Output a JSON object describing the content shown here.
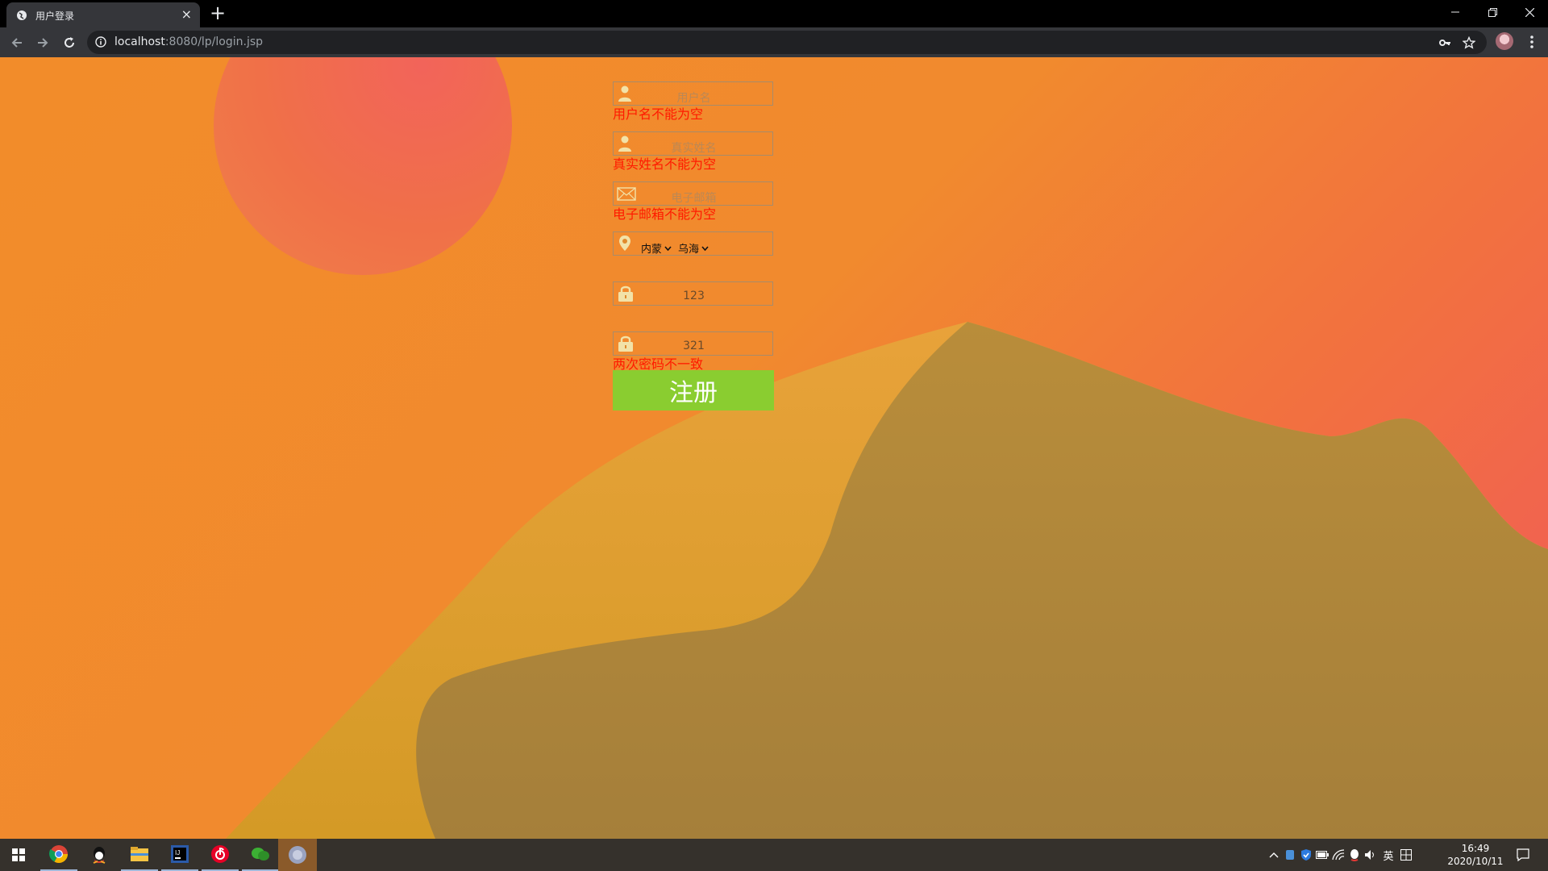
{
  "browser": {
    "tab_title": "用户登录",
    "tab_close": "×",
    "new_tab": "+",
    "url_host": "localhost",
    "url_path": ":8080/lp/login.jsp"
  },
  "form": {
    "username": {
      "placeholder": "用户名",
      "icon": "user-icon",
      "error": "用户名不能为空"
    },
    "realname": {
      "placeholder": "真实姓名",
      "icon": "user-icon",
      "error": "真实姓名不能为空"
    },
    "email": {
      "placeholder": "电子邮箱",
      "icon": "envelope-icon",
      "error": "电子邮箱不能为空"
    },
    "location": {
      "icon": "location-pin-icon",
      "province": "内蒙",
      "city": "乌海"
    },
    "password": {
      "value": "123",
      "icon": "lock-icon"
    },
    "confirm_password": {
      "value": "321",
      "icon": "lock-icon",
      "error": "两次密码不一致"
    },
    "submit_label": "注册"
  },
  "taskbar": {
    "apps": [
      "windows-start-icon",
      "chrome-icon",
      "qq-icon",
      "file-explorer-icon",
      "intellij-icon",
      "netease-music-icon",
      "wechat-leaf-icon",
      "photo-viewer-icon"
    ],
    "tray_lang": "英",
    "time": "16:49",
    "date": "2020/10/11"
  },
  "colors": {
    "error": "#ff1a00",
    "submit_bg": "#8acd30",
    "bg_orange": "#f28c2a",
    "bg_red": "#f05a5a"
  }
}
